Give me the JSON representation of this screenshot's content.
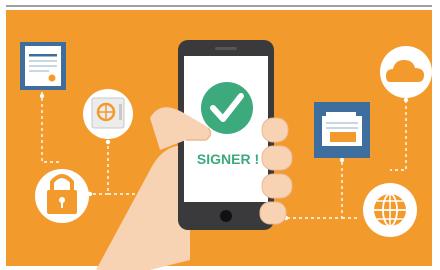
{
  "colors": {
    "background": "#F39A2C",
    "frame": "#FFFFFF",
    "phone_body": "#3A3A3C",
    "phone_screen": "#FFFFFF",
    "check_circle": "#3DAA7D",
    "signer_text": "#3DAA7D",
    "hand": "#F7D2B3",
    "hand_shadow": "#E9B995",
    "connector": "#FFFFFF",
    "document_blue": "#3D6E9E",
    "lock_orange": "#F39A2C",
    "cloud_orange": "#F39A2C",
    "globe_orange": "#F39A2C"
  },
  "phone": {
    "label": "SIGNER !",
    "check_icon": "check-circle-icon"
  },
  "icons": [
    "document-certificate-icon",
    "safe-icon",
    "padlock-icon",
    "cloud-icon",
    "folder-documents-icon",
    "globe-icon"
  ]
}
